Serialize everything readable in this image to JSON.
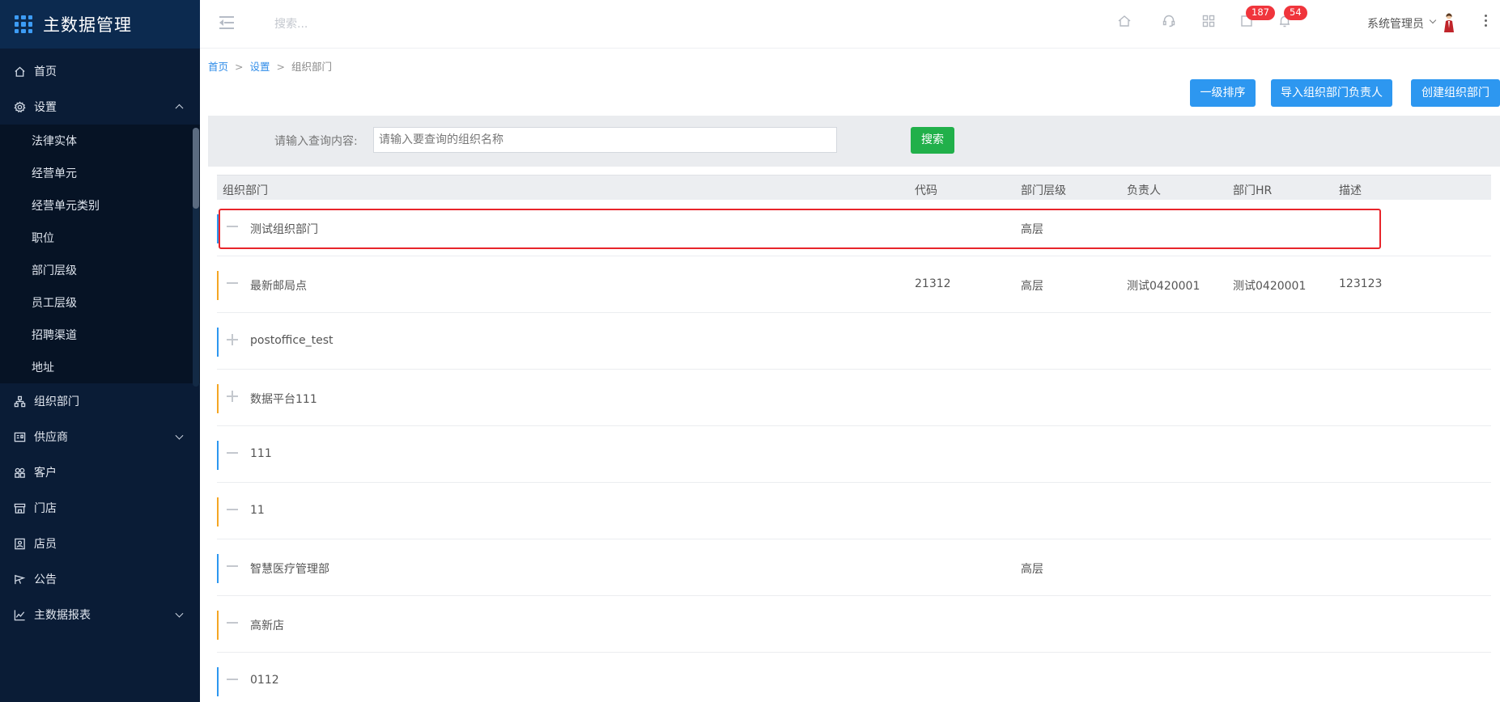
{
  "app": {
    "title": "主数据管理"
  },
  "sidebar": {
    "items": [
      {
        "label": "首页",
        "icon": "home-icon"
      },
      {
        "label": "设置",
        "icon": "gear-icon",
        "expanded": true,
        "children": [
          "法律实体",
          "经营单元",
          "经营单元类别",
          "职位",
          "部门层级",
          "员工层级",
          "招聘渠道",
          "地址"
        ]
      },
      {
        "label": "组织部门",
        "icon": "org-chart-icon"
      },
      {
        "label": "供应商",
        "icon": "supplier-icon",
        "collapsible": true
      },
      {
        "label": "客户",
        "icon": "customer-icon"
      },
      {
        "label": "门店",
        "icon": "store-icon"
      },
      {
        "label": "店员",
        "icon": "clerk-icon"
      },
      {
        "label": "公告",
        "icon": "announcement-icon"
      },
      {
        "label": "主数据报表",
        "icon": "chart-icon",
        "collapsible": true
      }
    ]
  },
  "header": {
    "search_placeholder": "搜索...",
    "icons": [
      "home-icon",
      "headset-icon",
      "apps-grid-icon",
      "task-icon",
      "bell-icon"
    ],
    "task_badge": "187",
    "notification_badge": "54",
    "user_name": "系统管理员"
  },
  "breadcrumb": {
    "home": "首页",
    "settings": "设置",
    "current": "组织部门",
    "separator": ">"
  },
  "actions": {
    "sort": "一级排序",
    "import_owner": "导入组织部门负责人",
    "create": "创建组织部门"
  },
  "search": {
    "label": "请输入查询内容:",
    "placeholder": "请输入要查询的组织名称",
    "button": "搜索"
  },
  "table": {
    "columns": {
      "name": "组织部门",
      "code": "代码",
      "level": "部门层级",
      "owner": "负责人",
      "hr": "部门HR",
      "desc": "描述"
    },
    "rows": [
      {
        "name": "测试组织部门",
        "code": "",
        "level": "高层",
        "owner": "",
        "hr": "",
        "desc": "",
        "expand": "collapse",
        "bar_color": "#2d97f0",
        "highlighted": true
      },
      {
        "name": "最新邮局点",
        "code": "21312",
        "level": "高层",
        "owner": "测试0420001",
        "hr": "测试0420001",
        "desc": "123123",
        "expand": "collapse",
        "bar_color": "#f5a623"
      },
      {
        "name": "postoffice_test",
        "code": "",
        "level": "",
        "owner": "",
        "hr": "",
        "desc": "",
        "expand": "expand",
        "bar_color": "#2d97f0"
      },
      {
        "name": "数据平台111",
        "code": "",
        "level": "",
        "owner": "",
        "hr": "",
        "desc": "",
        "expand": "expand",
        "bar_color": "#f5a623"
      },
      {
        "name": "111",
        "code": "",
        "level": "",
        "owner": "",
        "hr": "",
        "desc": "",
        "expand": "collapse",
        "bar_color": "#2d97f0"
      },
      {
        "name": "11",
        "code": "",
        "level": "",
        "owner": "",
        "hr": "",
        "desc": "",
        "expand": "collapse",
        "bar_color": "#f5a623"
      },
      {
        "name": "智慧医疗管理部",
        "code": "",
        "level": "高层",
        "owner": "",
        "hr": "",
        "desc": "",
        "expand": "collapse",
        "bar_color": "#2d97f0"
      },
      {
        "name": "高新店",
        "code": "",
        "level": "",
        "owner": "",
        "hr": "",
        "desc": "",
        "expand": "collapse",
        "bar_color": "#f5a623"
      },
      {
        "name": "0112",
        "code": "",
        "level": "",
        "owner": "",
        "hr": "",
        "desc": "",
        "expand": "collapse",
        "bar_color": "#2d97f0"
      }
    ]
  },
  "colors": {
    "sidebar_bg": "#0a1c36",
    "primary": "#2d97f0",
    "success": "#21b04a",
    "badge": "#f0353c",
    "highlight_border": "#e8252b"
  }
}
